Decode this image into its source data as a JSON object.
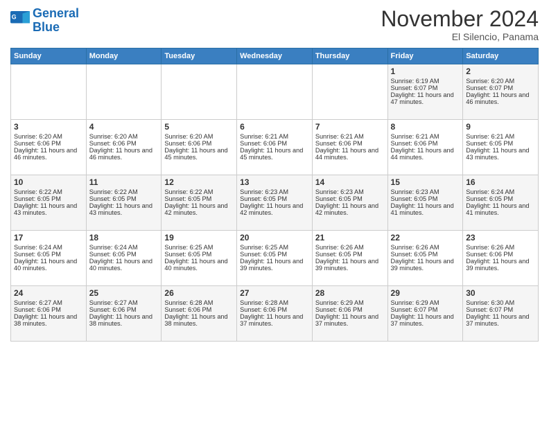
{
  "header": {
    "logo_line1": "General",
    "logo_line2": "Blue",
    "month": "November 2024",
    "location": "El Silencio, Panama"
  },
  "days_of_week": [
    "Sunday",
    "Monday",
    "Tuesday",
    "Wednesday",
    "Thursday",
    "Friday",
    "Saturday"
  ],
  "weeks": [
    [
      {
        "day": "",
        "sunrise": "",
        "sunset": "",
        "daylight": ""
      },
      {
        "day": "",
        "sunrise": "",
        "sunset": "",
        "daylight": ""
      },
      {
        "day": "",
        "sunrise": "",
        "sunset": "",
        "daylight": ""
      },
      {
        "day": "",
        "sunrise": "",
        "sunset": "",
        "daylight": ""
      },
      {
        "day": "",
        "sunrise": "",
        "sunset": "",
        "daylight": ""
      },
      {
        "day": "1",
        "sunrise": "Sunrise: 6:19 AM",
        "sunset": "Sunset: 6:07 PM",
        "daylight": "Daylight: 11 hours and 47 minutes."
      },
      {
        "day": "2",
        "sunrise": "Sunrise: 6:20 AM",
        "sunset": "Sunset: 6:07 PM",
        "daylight": "Daylight: 11 hours and 46 minutes."
      }
    ],
    [
      {
        "day": "3",
        "sunrise": "Sunrise: 6:20 AM",
        "sunset": "Sunset: 6:06 PM",
        "daylight": "Daylight: 11 hours and 46 minutes."
      },
      {
        "day": "4",
        "sunrise": "Sunrise: 6:20 AM",
        "sunset": "Sunset: 6:06 PM",
        "daylight": "Daylight: 11 hours and 46 minutes."
      },
      {
        "day": "5",
        "sunrise": "Sunrise: 6:20 AM",
        "sunset": "Sunset: 6:06 PM",
        "daylight": "Daylight: 11 hours and 45 minutes."
      },
      {
        "day": "6",
        "sunrise": "Sunrise: 6:21 AM",
        "sunset": "Sunset: 6:06 PM",
        "daylight": "Daylight: 11 hours and 45 minutes."
      },
      {
        "day": "7",
        "sunrise": "Sunrise: 6:21 AM",
        "sunset": "Sunset: 6:06 PM",
        "daylight": "Daylight: 11 hours and 44 minutes."
      },
      {
        "day": "8",
        "sunrise": "Sunrise: 6:21 AM",
        "sunset": "Sunset: 6:06 PM",
        "daylight": "Daylight: 11 hours and 44 minutes."
      },
      {
        "day": "9",
        "sunrise": "Sunrise: 6:21 AM",
        "sunset": "Sunset: 6:05 PM",
        "daylight": "Daylight: 11 hours and 43 minutes."
      }
    ],
    [
      {
        "day": "10",
        "sunrise": "Sunrise: 6:22 AM",
        "sunset": "Sunset: 6:05 PM",
        "daylight": "Daylight: 11 hours and 43 minutes."
      },
      {
        "day": "11",
        "sunrise": "Sunrise: 6:22 AM",
        "sunset": "Sunset: 6:05 PM",
        "daylight": "Daylight: 11 hours and 43 minutes."
      },
      {
        "day": "12",
        "sunrise": "Sunrise: 6:22 AM",
        "sunset": "Sunset: 6:05 PM",
        "daylight": "Daylight: 11 hours and 42 minutes."
      },
      {
        "day": "13",
        "sunrise": "Sunrise: 6:23 AM",
        "sunset": "Sunset: 6:05 PM",
        "daylight": "Daylight: 11 hours and 42 minutes."
      },
      {
        "day": "14",
        "sunrise": "Sunrise: 6:23 AM",
        "sunset": "Sunset: 6:05 PM",
        "daylight": "Daylight: 11 hours and 42 minutes."
      },
      {
        "day": "15",
        "sunrise": "Sunrise: 6:23 AM",
        "sunset": "Sunset: 6:05 PM",
        "daylight": "Daylight: 11 hours and 41 minutes."
      },
      {
        "day": "16",
        "sunrise": "Sunrise: 6:24 AM",
        "sunset": "Sunset: 6:05 PM",
        "daylight": "Daylight: 11 hours and 41 minutes."
      }
    ],
    [
      {
        "day": "17",
        "sunrise": "Sunrise: 6:24 AM",
        "sunset": "Sunset: 6:05 PM",
        "daylight": "Daylight: 11 hours and 40 minutes."
      },
      {
        "day": "18",
        "sunrise": "Sunrise: 6:24 AM",
        "sunset": "Sunset: 6:05 PM",
        "daylight": "Daylight: 11 hours and 40 minutes."
      },
      {
        "day": "19",
        "sunrise": "Sunrise: 6:25 AM",
        "sunset": "Sunset: 6:05 PM",
        "daylight": "Daylight: 11 hours and 40 minutes."
      },
      {
        "day": "20",
        "sunrise": "Sunrise: 6:25 AM",
        "sunset": "Sunset: 6:05 PM",
        "daylight": "Daylight: 11 hours and 39 minutes."
      },
      {
        "day": "21",
        "sunrise": "Sunrise: 6:26 AM",
        "sunset": "Sunset: 6:05 PM",
        "daylight": "Daylight: 11 hours and 39 minutes."
      },
      {
        "day": "22",
        "sunrise": "Sunrise: 6:26 AM",
        "sunset": "Sunset: 6:05 PM",
        "daylight": "Daylight: 11 hours and 39 minutes."
      },
      {
        "day": "23",
        "sunrise": "Sunrise: 6:26 AM",
        "sunset": "Sunset: 6:06 PM",
        "daylight": "Daylight: 11 hours and 39 minutes."
      }
    ],
    [
      {
        "day": "24",
        "sunrise": "Sunrise: 6:27 AM",
        "sunset": "Sunset: 6:06 PM",
        "daylight": "Daylight: 11 hours and 38 minutes."
      },
      {
        "day": "25",
        "sunrise": "Sunrise: 6:27 AM",
        "sunset": "Sunset: 6:06 PM",
        "daylight": "Daylight: 11 hours and 38 minutes."
      },
      {
        "day": "26",
        "sunrise": "Sunrise: 6:28 AM",
        "sunset": "Sunset: 6:06 PM",
        "daylight": "Daylight: 11 hours and 38 minutes."
      },
      {
        "day": "27",
        "sunrise": "Sunrise: 6:28 AM",
        "sunset": "Sunset: 6:06 PM",
        "daylight": "Daylight: 11 hours and 37 minutes."
      },
      {
        "day": "28",
        "sunrise": "Sunrise: 6:29 AM",
        "sunset": "Sunset: 6:06 PM",
        "daylight": "Daylight: 11 hours and 37 minutes."
      },
      {
        "day": "29",
        "sunrise": "Sunrise: 6:29 AM",
        "sunset": "Sunset: 6:07 PM",
        "daylight": "Daylight: 11 hours and 37 minutes."
      },
      {
        "day": "30",
        "sunrise": "Sunrise: 6:30 AM",
        "sunset": "Sunset: 6:07 PM",
        "daylight": "Daylight: 11 hours and 37 minutes."
      }
    ]
  ]
}
